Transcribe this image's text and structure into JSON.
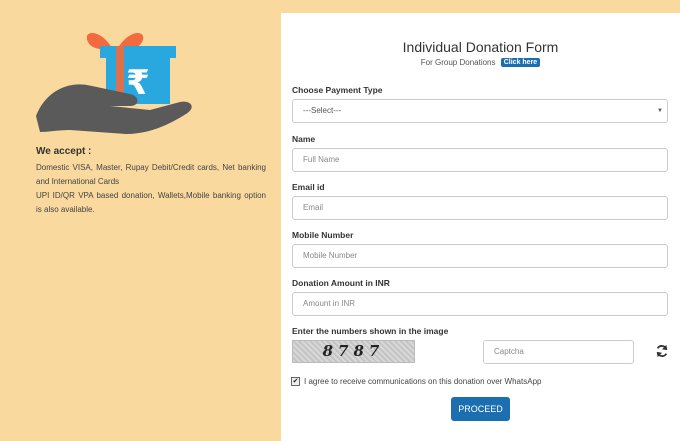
{
  "accept": {
    "title": "We accept :",
    "line1": "Domestic VISA, Master, Rupay Debit/Credit cards, Net banking and International Cards",
    "line2": "UPI ID/QR VPA based donation, Wallets,Mobile banking option is also available."
  },
  "form": {
    "title": "Individual Donation Form",
    "group_text": "For Group Donations",
    "click_here": "Click here",
    "payment_label": "Choose Payment Type",
    "payment_selected": "---Select---",
    "name_label": "Name",
    "name_placeholder": "Full Name",
    "email_label": "Email id",
    "email_placeholder": "Email",
    "mobile_label": "Mobile Number",
    "mobile_placeholder": "Mobile Number",
    "amount_label": "Donation Amount in INR",
    "amount_placeholder": "Amount in INR",
    "captcha_label": "Enter the numbers shown in the image",
    "captcha_image_text": "8787",
    "captcha_placeholder": "Captcha",
    "agree_text": "I agree to receive communications on this donation over WhatsApp",
    "agree_checked": true,
    "proceed_label": "PROCEED"
  },
  "icons": {
    "logo": "gift-in-hand-rupee-icon",
    "refresh": "refresh-icon",
    "dropdown": "chevron-down-icon"
  },
  "colors": {
    "background": "#f9d99e",
    "accent": "#1b6fb0",
    "gift_box": "#29a8e0",
    "ribbon": "#f26a3d",
    "hand": "#5a5a5a"
  }
}
